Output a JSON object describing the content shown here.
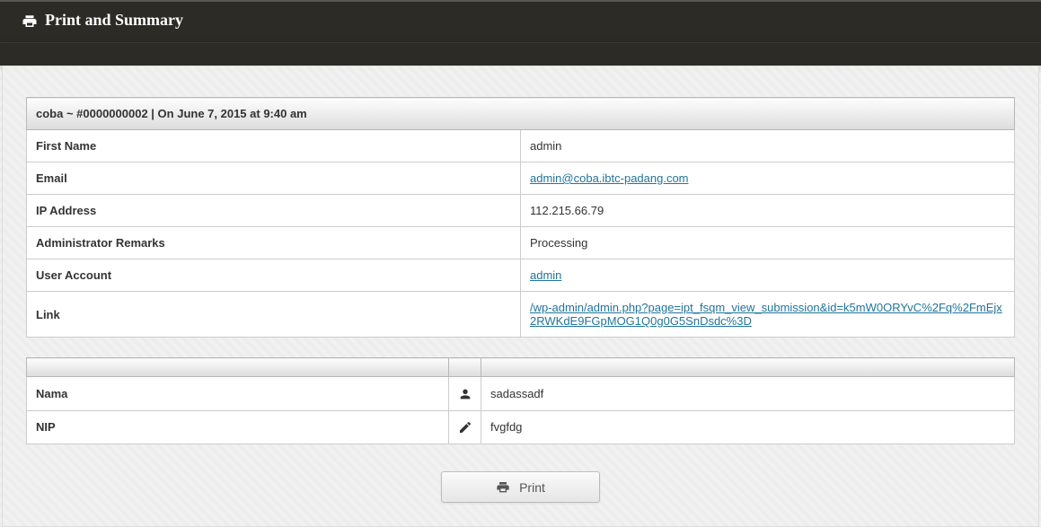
{
  "header": {
    "title": "Print and Summary"
  },
  "summary": {
    "header": "coba ~ #0000000002 | On June 7, 2015 at 9:40 am",
    "rows": {
      "first_name": {
        "label": "First Name",
        "value": "admin"
      },
      "email": {
        "label": "Email",
        "value": "admin@coba.ibtc-padang.com"
      },
      "ip": {
        "label": "IP Address",
        "value": "112.215.66.79"
      },
      "remarks": {
        "label": "Administrator Remarks",
        "value": "Processing"
      },
      "account": {
        "label": "User Account",
        "value": "admin"
      },
      "link": {
        "label": "Link",
        "value": "/wp-admin/admin.php?page=ipt_fsqm_view_submission&id=k5mW0ORYvC%2Fq%2FmEjx2RWKdE9FGpMOG1Q0g0G5SnDsdc%3D"
      }
    }
  },
  "fields": {
    "nama": {
      "label": "Nama",
      "value": "sadassadf"
    },
    "nip": {
      "label": "NIP",
      "value": "fvgfdg"
    }
  },
  "buttons": {
    "print": "Print"
  }
}
